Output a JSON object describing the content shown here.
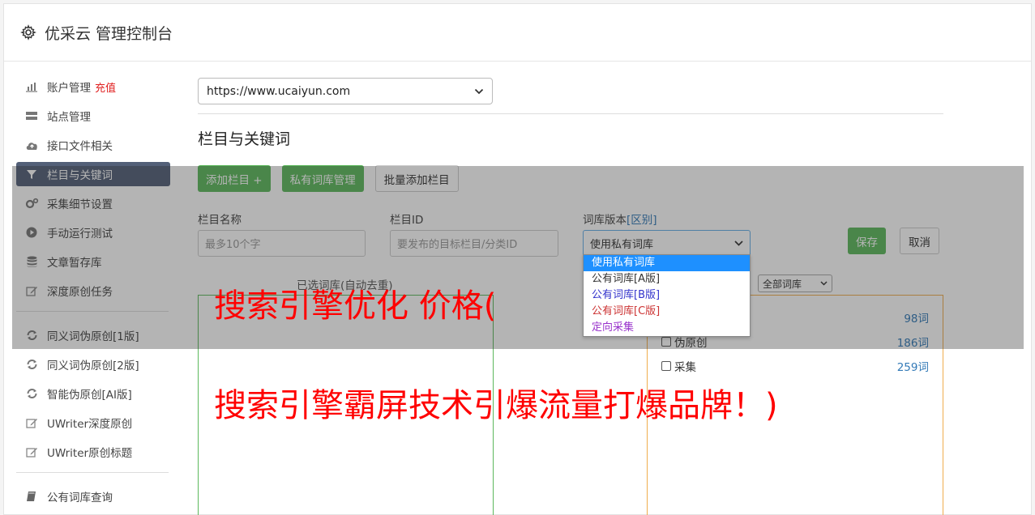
{
  "header": {
    "title": "优采云 管理控制台",
    "icon": "gear-icon"
  },
  "sidebar": {
    "items": [
      {
        "label": "账户管理",
        "badge": "充值",
        "icon": "bar-chart-icon"
      },
      {
        "label": "站点管理",
        "icon": "server-icon"
      },
      {
        "label": "接口文件相关",
        "icon": "cloud-upload-icon"
      },
      {
        "label": "栏目与关键词",
        "icon": "filter-icon",
        "active": true
      },
      {
        "label": "采集细节设置",
        "icon": "cogs-icon"
      },
      {
        "label": "手动运行测试",
        "icon": "play-icon"
      },
      {
        "label": "文章暂存库",
        "icon": "database-icon"
      },
      {
        "label": "深度原创任务",
        "icon": "edit-icon"
      }
    ],
    "items2": [
      {
        "label": "同义词伪原创[1版]",
        "icon": "refresh-icon"
      },
      {
        "label": "同义词伪原创[2版]",
        "icon": "refresh-icon"
      },
      {
        "label": "智能伪原创[AI版]",
        "icon": "refresh-icon"
      },
      {
        "label": "UWriter深度原创",
        "icon": "edit-icon"
      },
      {
        "label": "UWriter原创标题",
        "icon": "edit-icon"
      }
    ],
    "items3": [
      {
        "label": "公有词库查询",
        "icon": "book-icon"
      }
    ]
  },
  "main": {
    "site_select": "https://www.ucaiyun.com",
    "section_title": "栏目与关键词",
    "buttons": {
      "add_column": "添加栏目 +",
      "private_lib": "私有词库管理",
      "batch_add": "批量添加栏目"
    },
    "form": {
      "column_name_label": "栏目名称",
      "column_name_placeholder": "最多10个字",
      "column_id_label": "栏目ID",
      "column_id_placeholder": "要发布的目标栏目/分类ID",
      "lib_version_label": "词库版本",
      "lib_version_link": "[区别]",
      "lib_version_value": "使用私有词库",
      "save": "保存",
      "cancel": "取消"
    },
    "dropdown_options": [
      {
        "label": "使用私有词库",
        "color": "#ffffff"
      },
      {
        "label": "公有词库[A版]",
        "color": "#333333"
      },
      {
        "label": "公有词库[B版]",
        "color": "#3333cc"
      },
      {
        "label": "公有词库[C版]",
        "color": "#cc3333"
      },
      {
        "label": "定向采集",
        "color": "#9933cc"
      }
    ],
    "selected_words_title": "已选词库(自动去重)",
    "lib_filter": "全部词库",
    "lib_rows": [
      {
        "name": "",
        "count": "98词"
      },
      {
        "name": "伪原创",
        "count": "186词"
      },
      {
        "name": "采集",
        "count": "259词"
      }
    ]
  },
  "ad": {
    "line1": "搜索引擎优化 价格(",
    "line2": "搜索引擎霸屏技术引爆流量打爆品牌！)"
  }
}
